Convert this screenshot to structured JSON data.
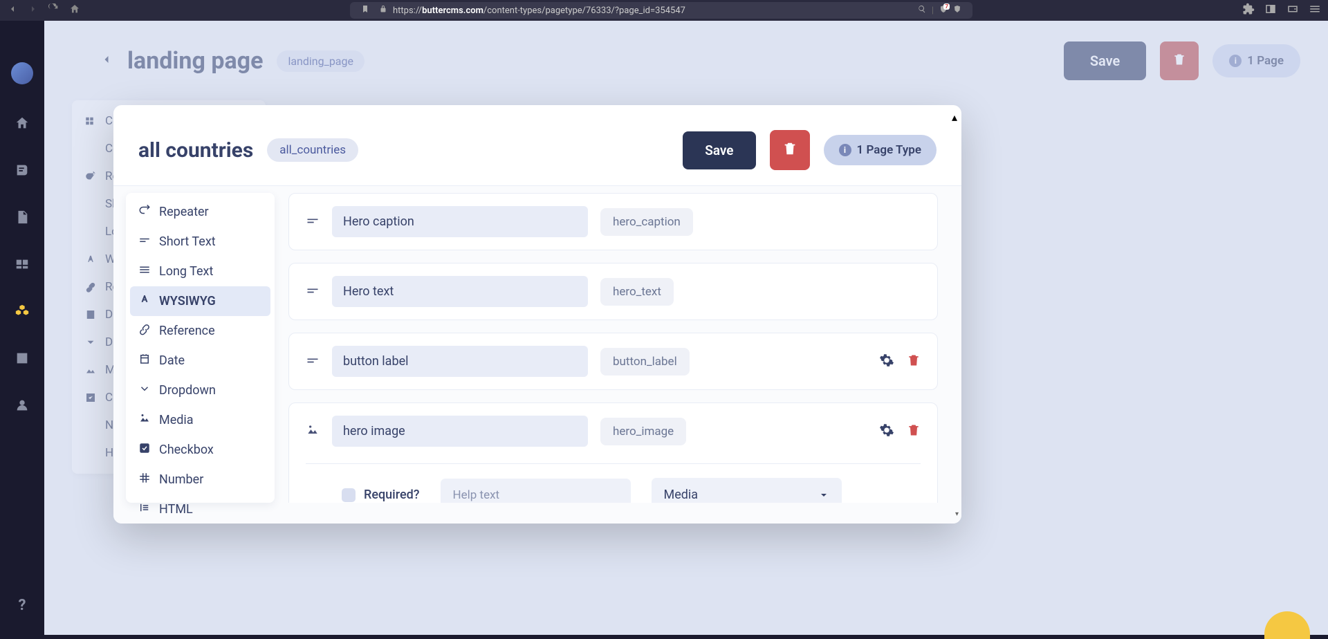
{
  "browser": {
    "url_prefix": "https://",
    "url_domain": "buttercms.com",
    "url_path": "/content-types/pagetype/76333/?page_id=354547",
    "shield_badge": "7"
  },
  "bg_page": {
    "title": "landing page",
    "slug": "landing_page",
    "save_label": "Save",
    "page_count": "1 Page",
    "left_items": [
      "Co",
      "Co",
      "Rep",
      "Sho",
      "Lor",
      "WY",
      "Ref",
      "Dat",
      "Dro",
      "Me",
      "Che",
      "Nu",
      "HT"
    ]
  },
  "modal": {
    "title": "all countries",
    "slug": "all_countries",
    "save_label": "Save",
    "type_count": "1 Page Type",
    "field_types": [
      {
        "label": "Repeater",
        "icon": "repeat"
      },
      {
        "label": "Short Text",
        "icon": "short"
      },
      {
        "label": "Long Text",
        "icon": "long"
      },
      {
        "label": "WYSIWYG",
        "icon": "wysiwyg",
        "active": true
      },
      {
        "label": "Reference",
        "icon": "link"
      },
      {
        "label": "Date",
        "icon": "date"
      },
      {
        "label": "Dropdown",
        "icon": "chevron"
      },
      {
        "label": "Media",
        "icon": "media"
      },
      {
        "label": "Checkbox",
        "icon": "check"
      },
      {
        "label": "Number",
        "icon": "hash"
      },
      {
        "label": "HTML",
        "icon": "html"
      }
    ],
    "fields": [
      {
        "name": "Hero caption",
        "slug": "hero_caption",
        "icon": "short",
        "actions": false
      },
      {
        "name": "Hero text",
        "slug": "hero_text",
        "icon": "short",
        "actions": false
      },
      {
        "name": "button label",
        "slug": "button_label",
        "icon": "short",
        "actions": true
      },
      {
        "name": "hero image",
        "slug": "hero_image",
        "icon": "media",
        "actions": true,
        "expanded": true
      }
    ],
    "settings": {
      "required_label": "Required?",
      "help_placeholder": "Help text",
      "type_value": "Media"
    }
  }
}
